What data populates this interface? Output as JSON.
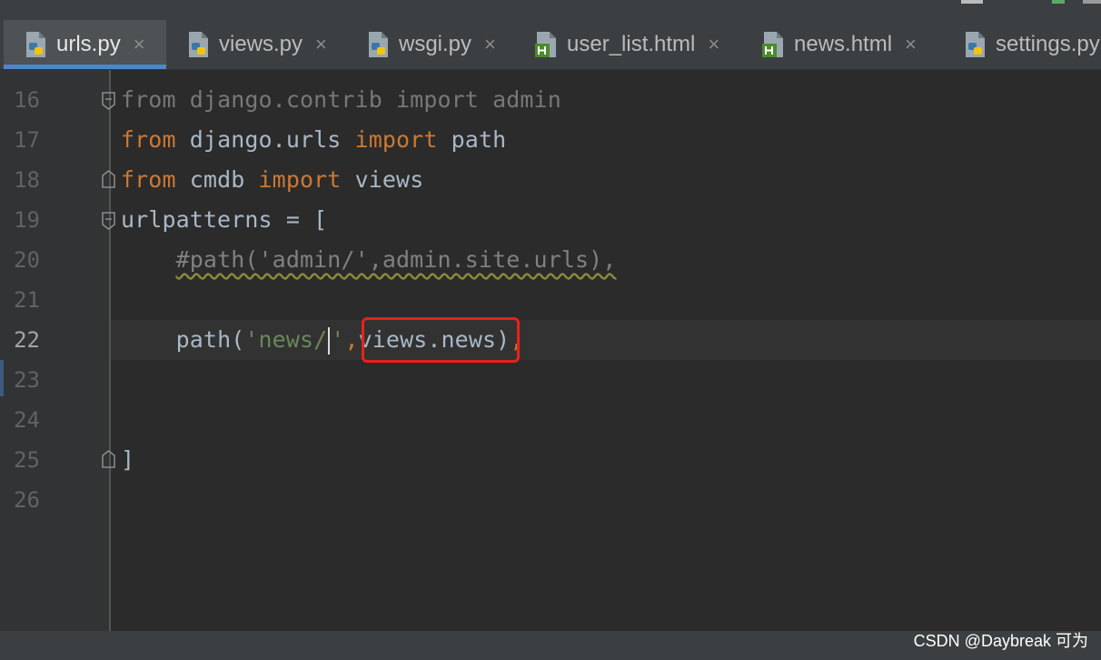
{
  "tabs": [
    {
      "label": "urls.py",
      "icon": "python-file-icon",
      "active": true
    },
    {
      "label": "views.py",
      "icon": "python-file-icon",
      "active": false
    },
    {
      "label": "wsgi.py",
      "icon": "python-file-icon",
      "active": false
    },
    {
      "label": "user_list.html",
      "icon": "html-file-icon",
      "active": false
    },
    {
      "label": "news.html",
      "icon": "html-file-icon",
      "active": false
    },
    {
      "label": "settings.py",
      "icon": "python-file-icon",
      "active": false
    }
  ],
  "tab_close_glyph": "×",
  "editor": {
    "line_numbers": [
      "16",
      "17",
      "18",
      "19",
      "20",
      "21",
      "22",
      "23",
      "24",
      "25",
      "26"
    ],
    "current_line": "22",
    "code": {
      "l16": {
        "kw1": "from",
        "mod": " django.contrib ",
        "kw2": "import",
        "name": " admin"
      },
      "l17": {
        "kw1": "from",
        "mod": " django.urls ",
        "kw2": "import",
        "name": " path"
      },
      "l18": {
        "kw1": "from",
        "mod": " cmdb ",
        "kw2": "import",
        "name": " views"
      },
      "l19": {
        "text": "urlpatterns = ["
      },
      "l20": {
        "indent": "    ",
        "comment": "#path('admin/',admin.site.urls),"
      },
      "l22": {
        "indent": "    ",
        "fn": "path(",
        "str_before_caret": "'news/",
        "str_after_caret": "'",
        "comma1": ",",
        "ref": "views.news",
        "close": ")",
        "comma2": ","
      },
      "l25": {
        "text": "]"
      }
    }
  },
  "colors": {
    "keyword": "#cc7832",
    "string": "#6a8759",
    "default_text": "#a9b7c6",
    "comment": "#808080",
    "highlight_box": "#e5231b",
    "active_tab_underline": "#4a88c7"
  },
  "watermark": "CSDN @Daybreak 可为"
}
